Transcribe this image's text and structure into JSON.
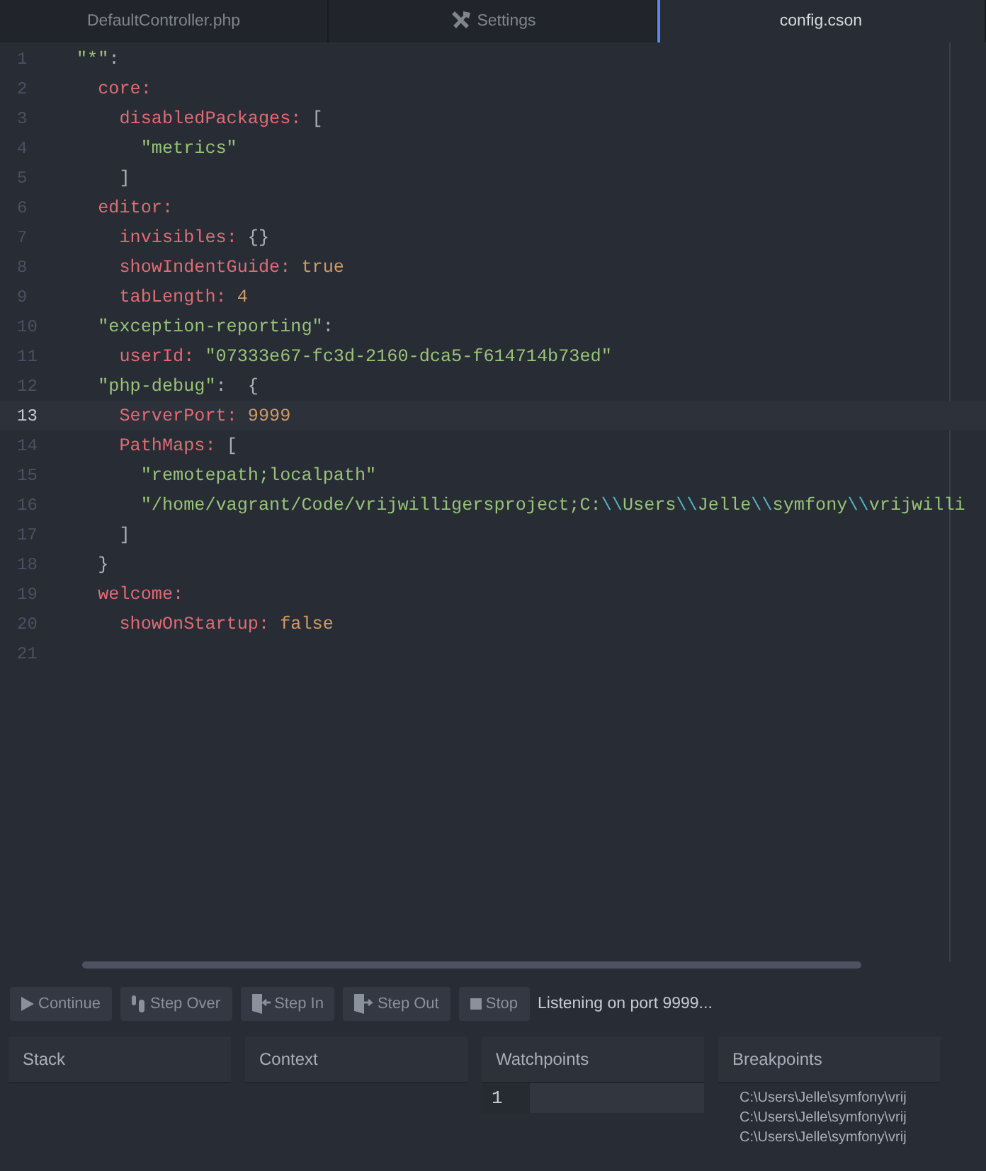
{
  "tabs": [
    {
      "label": "DefaultController.php",
      "icon": false,
      "selected": false
    },
    {
      "label": "Settings",
      "icon": true,
      "selected": false
    },
    {
      "label": "config.cson",
      "icon": false,
      "selected": true
    }
  ],
  "editor": {
    "lines": [
      {
        "number": "1",
        "current": false,
        "tokens": [
          {
            "kind": "string",
            "text": "\"*\""
          },
          {
            "kind": "punct",
            "text": ":"
          }
        ]
      },
      {
        "number": "2",
        "current": false,
        "tokens": [
          {
            "kind": "key",
            "text": "  core"
          },
          {
            "kind": "key",
            "text": ":"
          }
        ]
      },
      {
        "number": "3",
        "current": false,
        "tokens": [
          {
            "kind": "key",
            "text": "    disabledPackages"
          },
          {
            "kind": "key",
            "text": ":"
          },
          {
            "kind": "punct",
            "text": " ["
          }
        ]
      },
      {
        "number": "4",
        "current": false,
        "tokens": [
          {
            "kind": "string",
            "text": "      \"metrics\""
          }
        ]
      },
      {
        "number": "5",
        "current": false,
        "tokens": [
          {
            "kind": "punct",
            "text": "    ]"
          }
        ]
      },
      {
        "number": "6",
        "current": false,
        "tokens": [
          {
            "kind": "key",
            "text": "  editor"
          },
          {
            "kind": "key",
            "text": ":"
          }
        ]
      },
      {
        "number": "7",
        "current": false,
        "tokens": [
          {
            "kind": "key",
            "text": "    invisibles"
          },
          {
            "kind": "key",
            "text": ":"
          },
          {
            "kind": "punct",
            "text": " {}"
          }
        ]
      },
      {
        "number": "8",
        "current": false,
        "tokens": [
          {
            "kind": "key",
            "text": "    showIndentGuide"
          },
          {
            "kind": "key",
            "text": ":"
          },
          {
            "kind": "bool",
            "text": " true"
          }
        ]
      },
      {
        "number": "9",
        "current": false,
        "tokens": [
          {
            "kind": "key",
            "text": "    tabLength"
          },
          {
            "kind": "key",
            "text": ":"
          },
          {
            "kind": "number",
            "text": " 4"
          }
        ]
      },
      {
        "number": "10",
        "current": false,
        "tokens": [
          {
            "kind": "string",
            "text": "  \"exception-reporting\""
          },
          {
            "kind": "punct",
            "text": ":"
          }
        ]
      },
      {
        "number": "11",
        "current": false,
        "tokens": [
          {
            "kind": "key",
            "text": "    userId"
          },
          {
            "kind": "key",
            "text": ":"
          },
          {
            "kind": "string",
            "text": " \"07333e67-fc3d-2160-dca5-f614714b73ed\""
          }
        ]
      },
      {
        "number": "12",
        "current": false,
        "tokens": [
          {
            "kind": "string",
            "text": "  \"php-debug\""
          },
          {
            "kind": "punct",
            "text": ":  {"
          }
        ]
      },
      {
        "number": "13",
        "current": true,
        "tokens": [
          {
            "kind": "key",
            "text": "    ServerPort"
          },
          {
            "kind": "key",
            "text": ":"
          },
          {
            "kind": "number",
            "text": " 9999"
          }
        ]
      },
      {
        "number": "14",
        "current": false,
        "tokens": [
          {
            "kind": "key",
            "text": "    PathMaps"
          },
          {
            "kind": "key",
            "text": ":"
          },
          {
            "kind": "punct",
            "text": " ["
          }
        ]
      },
      {
        "number": "15",
        "current": false,
        "tokens": [
          {
            "kind": "string",
            "text": "      \"remotepath;localpath\""
          }
        ]
      },
      {
        "number": "16",
        "current": false,
        "tokens": [
          {
            "kind": "string",
            "text": "      \"/home/vagrant/Code/vrijwilligersproject;C:"
          },
          {
            "kind": "escape",
            "text": "\\\\"
          },
          {
            "kind": "string",
            "text": "Users"
          },
          {
            "kind": "escape",
            "text": "\\\\"
          },
          {
            "kind": "string",
            "text": "Jelle"
          },
          {
            "kind": "escape",
            "text": "\\\\"
          },
          {
            "kind": "string",
            "text": "symfony"
          },
          {
            "kind": "escape",
            "text": "\\\\"
          },
          {
            "kind": "string",
            "text": "vrijwilli"
          }
        ]
      },
      {
        "number": "17",
        "current": false,
        "tokens": [
          {
            "kind": "punct",
            "text": "    ]"
          }
        ]
      },
      {
        "number": "18",
        "current": false,
        "tokens": [
          {
            "kind": "punct",
            "text": "  }"
          }
        ]
      },
      {
        "number": "19",
        "current": false,
        "tokens": [
          {
            "kind": "key",
            "text": "  welcome"
          },
          {
            "kind": "key",
            "text": ":"
          }
        ]
      },
      {
        "number": "20",
        "current": false,
        "tokens": [
          {
            "kind": "key",
            "text": "    showOnStartup"
          },
          {
            "kind": "key",
            "text": ":"
          },
          {
            "kind": "bool",
            "text": " false"
          }
        ]
      },
      {
        "number": "21",
        "current": false
      }
    ]
  },
  "debug_toolbar": {
    "buttons": [
      {
        "kind": "play",
        "label": "Continue"
      },
      {
        "kind": "over",
        "label": "Step Over"
      },
      {
        "kind": "in",
        "label": "Step In"
      },
      {
        "kind": "out",
        "label": "Step Out"
      },
      {
        "kind": "stop",
        "label": "Stop"
      }
    ],
    "status": "Listening on port 9999..."
  },
  "panels": {
    "stack": {
      "title": "Stack"
    },
    "context": {
      "title": "Context"
    },
    "watchpoints": {
      "title": "Watchpoints",
      "rows": [
        {
          "number": "1"
        }
      ]
    },
    "breakpoints": {
      "title": "Breakpoints",
      "items": [
        "C:\\Users\\Jelle\\symfony\\vrij",
        "C:\\Users\\Jelle\\symfony\\vrij",
        "C:\\Users\\Jelle\\symfony\\vrij"
      ]
    }
  }
}
